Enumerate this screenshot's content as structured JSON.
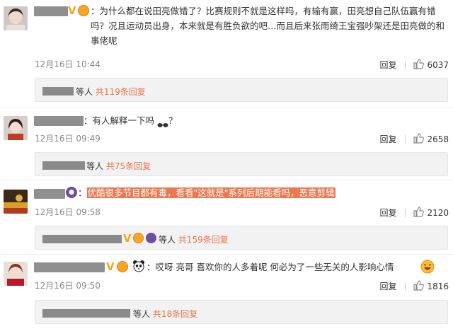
{
  "comments": [
    {
      "text": "：为什么都在说田亮做错了？比赛规则不就是这样吗，有输有赢，田亮想自己队伍赢有错吗？况且运动员出身，本来就是有胜负欲的吧…而且后来张雨绮王宝强吵架还是田亮做的和事佬呢",
      "time": "12月16日 10:44",
      "reply_label": "回复",
      "likes": "6037",
      "sub_suffix": "等人",
      "sub_link": "共119条回复"
    },
    {
      "text": "：有人解释一下吗",
      "text_tail": "？",
      "time": "12月16日 09:49",
      "reply_label": "回复",
      "likes": "2658",
      "sub_suffix": "等人",
      "sub_link": "共75条回复"
    },
    {
      "text": "：",
      "highlight": "优酷很多节目都有毒，看看\"这就是\"系列后期能看吗，恶意剪辑",
      "time": "12月16日 09:58",
      "reply_label": "回复",
      "likes": "2120",
      "sub_suffix": "等人",
      "sub_link": "共159条回复"
    },
    {
      "text": "：哎呀 亮哥  喜欢你的人多着呢  何必为了一些无关的人影响心情",
      "time": "12月16日 09:50",
      "reply_label": "回复",
      "likes": "1816",
      "sub_suffix": "等人",
      "sub_link": "共18条回复"
    }
  ],
  "colors": {
    "link": "#eb7350",
    "highlight": "#eb7850",
    "vip": "#f5a623"
  },
  "icons": [
    "avatar",
    "vip-v-icon",
    "vip-crown-icon",
    "thumbs-up-icon",
    "sunglasses-emoji-icon",
    "panda-emoji-icon",
    "laughing-emoji-icon",
    "youku-badge-icon"
  ]
}
